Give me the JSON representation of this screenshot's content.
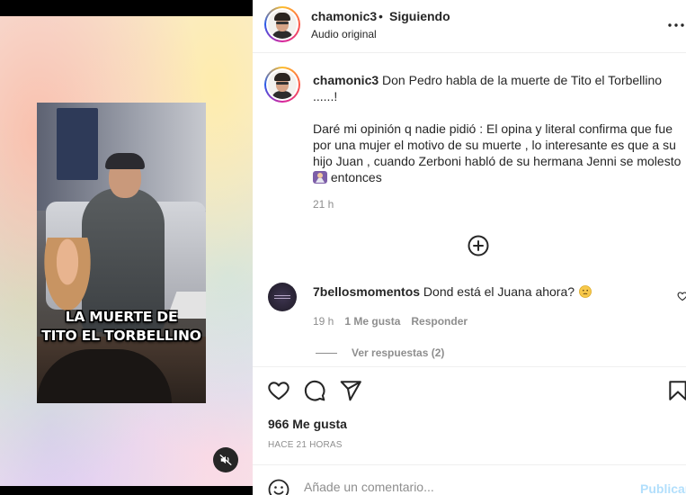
{
  "post": {
    "username": "chamonic3",
    "separator": "•",
    "follow_status": "Siguiendo",
    "audio": "Audio original",
    "video_caption_line1": "LA MUERTE DE",
    "video_caption_line2": "TITO EL TORBELLINO"
  },
  "caption": {
    "username": "chamonic3",
    "line1": "Don Pedro habla de la muerte de Tito el Torbellino",
    "line2": "......!",
    "line3": "Daré mi opinión q nadie pidió : El opina y literal confirma que fue por una mujer el motivo de su muerte , lo interesante es que a su hijo Juan , cuando Zerboni habló de su hermana Jenni se molesto",
    "line3_end": "entonces",
    "time": "21 h"
  },
  "comment": {
    "username": "7bellosmomentos",
    "text": "Dond está el Juana ahora?",
    "time": "19 h",
    "likes": "1 Me gusta",
    "reply_label": "Responder",
    "view_replies": "Ver respuestas (2)"
  },
  "engagement": {
    "likes": "966 Me gusta",
    "date": "HACE 21 HORAS"
  },
  "composer": {
    "placeholder": "Añade un comentario...",
    "publish_label": "Publicar"
  },
  "icons": {
    "more": "more-horizontal-icon",
    "add_comments": "plus-circle-icon",
    "like": "heart-icon",
    "comment": "comment-icon",
    "share": "paper-plane-icon",
    "save": "bookmark-icon",
    "emoji": "smiley-icon",
    "mute": "speaker-muted-icon"
  }
}
